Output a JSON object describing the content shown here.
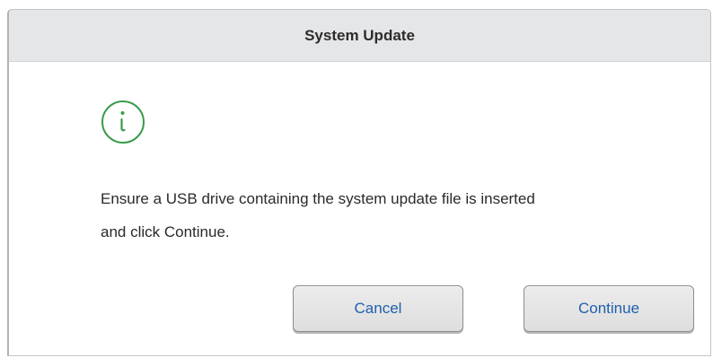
{
  "dialog": {
    "title": "System Update",
    "icon": "info-circle-icon",
    "message_lines": [
      "Ensure a USB drive containing the system update file is inserted",
      "and click Continue."
    ],
    "buttons": {
      "cancel_label": "Cancel",
      "continue_label": "Continue"
    }
  },
  "colors": {
    "icon": "#3a9b4c",
    "button_text": "#1f5fae",
    "titlebar_bg": "#e5e6e8"
  }
}
